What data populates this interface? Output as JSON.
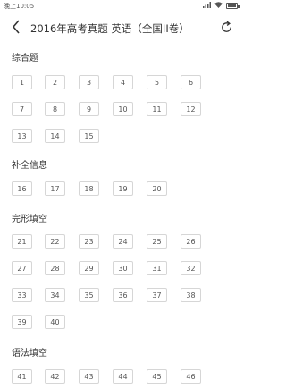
{
  "status_bar": {
    "time": "晚上10:05",
    "icons": [
      "signal-icon",
      "wifi-icon",
      "battery-icon"
    ],
    "battery_level": 0.8
  },
  "header": {
    "back_icon": "chevron-left-icon",
    "title": "2016年高考真题 英语（全国II卷）",
    "refresh_icon": "refresh-icon"
  },
  "colors": {
    "text": "#333333",
    "button_border": "#d6d6d6",
    "button_text": "#555555",
    "background": "#ffffff"
  },
  "sections": [
    {
      "title": "综合题",
      "questions": [
        "1",
        "2",
        "3",
        "4",
        "5",
        "6",
        "7",
        "8",
        "9",
        "10",
        "11",
        "12",
        "13",
        "14",
        "15"
      ]
    },
    {
      "title": "补全信息",
      "questions": [
        "16",
        "17",
        "18",
        "19",
        "20"
      ]
    },
    {
      "title": "完形填空",
      "questions": [
        "21",
        "22",
        "23",
        "24",
        "25",
        "26",
        "27",
        "28",
        "29",
        "30",
        "31",
        "32",
        "33",
        "34",
        "35",
        "36",
        "37",
        "38",
        "39",
        "40"
      ]
    },
    {
      "title": "语法填空",
      "questions": [
        "41",
        "42",
        "43",
        "44",
        "45",
        "46"
      ]
    }
  ]
}
